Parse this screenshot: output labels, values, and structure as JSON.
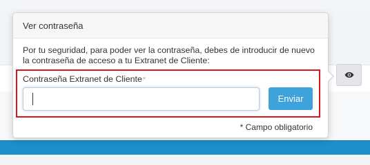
{
  "popover": {
    "title": "Ver contraseña",
    "message": "Por tu seguridad, para poder ver la contraseña, debes de introducir de nuevo la contraseña de acceso a tu Extranet de Cliente:",
    "field": {
      "label": "Contraseña Extranet de Cliente",
      "required_mark": "*",
      "value": "",
      "placeholder": ""
    },
    "submit_label": "Enviar",
    "required_note": "* Campo obligatorio"
  },
  "background": {
    "reveal_button_icon": "eye-icon"
  },
  "colors": {
    "accent": "#3ea3da",
    "highlight_border": "#d9141a",
    "bottom_bar": "#1d8fc9"
  }
}
